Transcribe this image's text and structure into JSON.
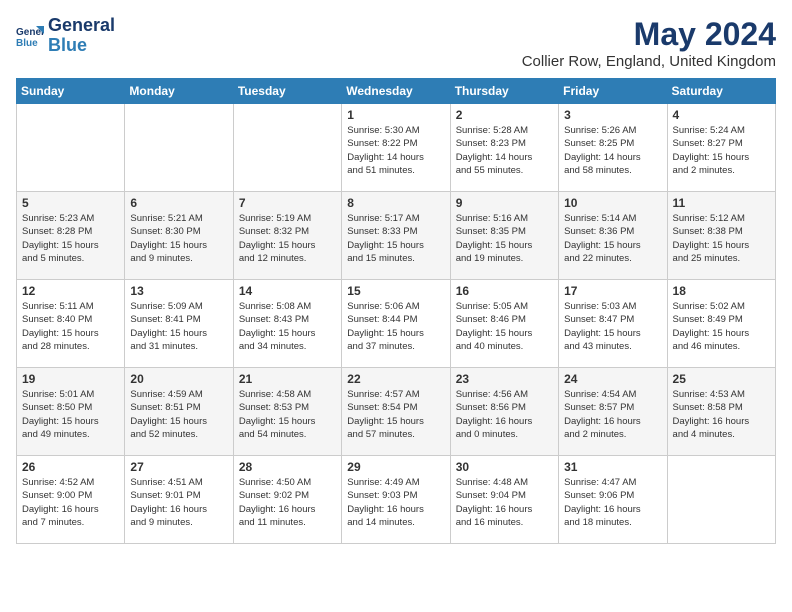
{
  "logo": {
    "line1": "General",
    "line2": "Blue"
  },
  "title": "May 2024",
  "subtitle": "Collier Row, England, United Kingdom",
  "days_of_week": [
    "Sunday",
    "Monday",
    "Tuesday",
    "Wednesday",
    "Thursday",
    "Friday",
    "Saturday"
  ],
  "weeks": [
    [
      {
        "day": "",
        "info": ""
      },
      {
        "day": "",
        "info": ""
      },
      {
        "day": "",
        "info": ""
      },
      {
        "day": "1",
        "info": "Sunrise: 5:30 AM\nSunset: 8:22 PM\nDaylight: 14 hours\nand 51 minutes."
      },
      {
        "day": "2",
        "info": "Sunrise: 5:28 AM\nSunset: 8:23 PM\nDaylight: 14 hours\nand 55 minutes."
      },
      {
        "day": "3",
        "info": "Sunrise: 5:26 AM\nSunset: 8:25 PM\nDaylight: 14 hours\nand 58 minutes."
      },
      {
        "day": "4",
        "info": "Sunrise: 5:24 AM\nSunset: 8:27 PM\nDaylight: 15 hours\nand 2 minutes."
      }
    ],
    [
      {
        "day": "5",
        "info": "Sunrise: 5:23 AM\nSunset: 8:28 PM\nDaylight: 15 hours\nand 5 minutes."
      },
      {
        "day": "6",
        "info": "Sunrise: 5:21 AM\nSunset: 8:30 PM\nDaylight: 15 hours\nand 9 minutes."
      },
      {
        "day": "7",
        "info": "Sunrise: 5:19 AM\nSunset: 8:32 PM\nDaylight: 15 hours\nand 12 minutes."
      },
      {
        "day": "8",
        "info": "Sunrise: 5:17 AM\nSunset: 8:33 PM\nDaylight: 15 hours\nand 15 minutes."
      },
      {
        "day": "9",
        "info": "Sunrise: 5:16 AM\nSunset: 8:35 PM\nDaylight: 15 hours\nand 19 minutes."
      },
      {
        "day": "10",
        "info": "Sunrise: 5:14 AM\nSunset: 8:36 PM\nDaylight: 15 hours\nand 22 minutes."
      },
      {
        "day": "11",
        "info": "Sunrise: 5:12 AM\nSunset: 8:38 PM\nDaylight: 15 hours\nand 25 minutes."
      }
    ],
    [
      {
        "day": "12",
        "info": "Sunrise: 5:11 AM\nSunset: 8:40 PM\nDaylight: 15 hours\nand 28 minutes."
      },
      {
        "day": "13",
        "info": "Sunrise: 5:09 AM\nSunset: 8:41 PM\nDaylight: 15 hours\nand 31 minutes."
      },
      {
        "day": "14",
        "info": "Sunrise: 5:08 AM\nSunset: 8:43 PM\nDaylight: 15 hours\nand 34 minutes."
      },
      {
        "day": "15",
        "info": "Sunrise: 5:06 AM\nSunset: 8:44 PM\nDaylight: 15 hours\nand 37 minutes."
      },
      {
        "day": "16",
        "info": "Sunrise: 5:05 AM\nSunset: 8:46 PM\nDaylight: 15 hours\nand 40 minutes."
      },
      {
        "day": "17",
        "info": "Sunrise: 5:03 AM\nSunset: 8:47 PM\nDaylight: 15 hours\nand 43 minutes."
      },
      {
        "day": "18",
        "info": "Sunrise: 5:02 AM\nSunset: 8:49 PM\nDaylight: 15 hours\nand 46 minutes."
      }
    ],
    [
      {
        "day": "19",
        "info": "Sunrise: 5:01 AM\nSunset: 8:50 PM\nDaylight: 15 hours\nand 49 minutes."
      },
      {
        "day": "20",
        "info": "Sunrise: 4:59 AM\nSunset: 8:51 PM\nDaylight: 15 hours\nand 52 minutes."
      },
      {
        "day": "21",
        "info": "Sunrise: 4:58 AM\nSunset: 8:53 PM\nDaylight: 15 hours\nand 54 minutes."
      },
      {
        "day": "22",
        "info": "Sunrise: 4:57 AM\nSunset: 8:54 PM\nDaylight: 15 hours\nand 57 minutes."
      },
      {
        "day": "23",
        "info": "Sunrise: 4:56 AM\nSunset: 8:56 PM\nDaylight: 16 hours\nand 0 minutes."
      },
      {
        "day": "24",
        "info": "Sunrise: 4:54 AM\nSunset: 8:57 PM\nDaylight: 16 hours\nand 2 minutes."
      },
      {
        "day": "25",
        "info": "Sunrise: 4:53 AM\nSunset: 8:58 PM\nDaylight: 16 hours\nand 4 minutes."
      }
    ],
    [
      {
        "day": "26",
        "info": "Sunrise: 4:52 AM\nSunset: 9:00 PM\nDaylight: 16 hours\nand 7 minutes."
      },
      {
        "day": "27",
        "info": "Sunrise: 4:51 AM\nSunset: 9:01 PM\nDaylight: 16 hours\nand 9 minutes."
      },
      {
        "day": "28",
        "info": "Sunrise: 4:50 AM\nSunset: 9:02 PM\nDaylight: 16 hours\nand 11 minutes."
      },
      {
        "day": "29",
        "info": "Sunrise: 4:49 AM\nSunset: 9:03 PM\nDaylight: 16 hours\nand 14 minutes."
      },
      {
        "day": "30",
        "info": "Sunrise: 4:48 AM\nSunset: 9:04 PM\nDaylight: 16 hours\nand 16 minutes."
      },
      {
        "day": "31",
        "info": "Sunrise: 4:47 AM\nSunset: 9:06 PM\nDaylight: 16 hours\nand 18 minutes."
      },
      {
        "day": "",
        "info": ""
      }
    ]
  ]
}
